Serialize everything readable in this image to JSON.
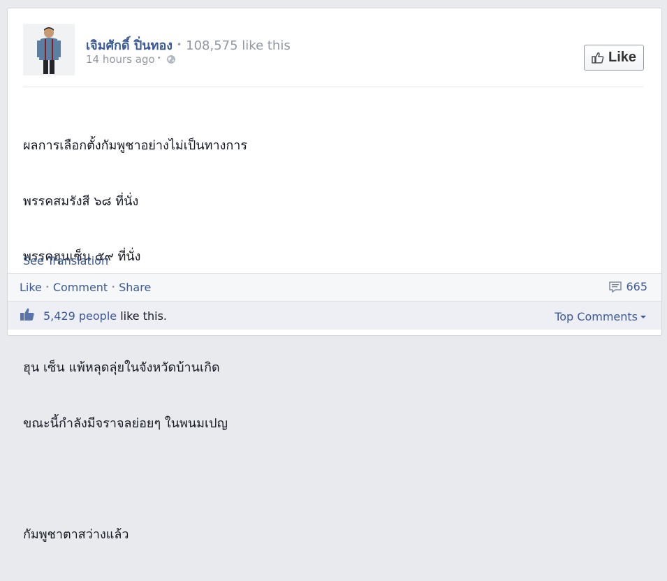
{
  "post": {
    "author_name": "เจิมศักดิ์ ปิ่นทอง",
    "page_likes": "108,575 like this",
    "timestamp": "14 hours ago",
    "like_button_label": "Like",
    "body_lines": [
      "ผลการเลือกตั้งกัมพูชาอย่างไม่เป็นทางการ",
      "พรรคสมรังสี ๖๘ ที่นั่ง",
      "พรรคฮุนเซ็น ๕๙ ที่นั่ง",
      "",
      "ฮุน เซ็น แพ้หลุดลุ่ยในจังหวัดบ้านเกิด",
      "ขณะนี้กำลังมีจราจลย่อยๆ ในพนมเปญ",
      "",
      "กัมพูชาตาสว่างแล้ว"
    ],
    "see_translation": "See Translation"
  },
  "actions": {
    "like": "Like",
    "comment": "Comment",
    "share": "Share",
    "comment_count": "665"
  },
  "likes_bar": {
    "people_count": "5,429 people",
    "suffix": "like this.",
    "sort_label": "Top Comments"
  },
  "colors": {
    "link": "#3b5998",
    "muted": "#9197a3",
    "text": "#141823"
  },
  "icons": {
    "thumb": "thumbs-up-icon",
    "globe": "globe-icon",
    "comment": "comment-icon",
    "caret": "caret-down-icon"
  }
}
